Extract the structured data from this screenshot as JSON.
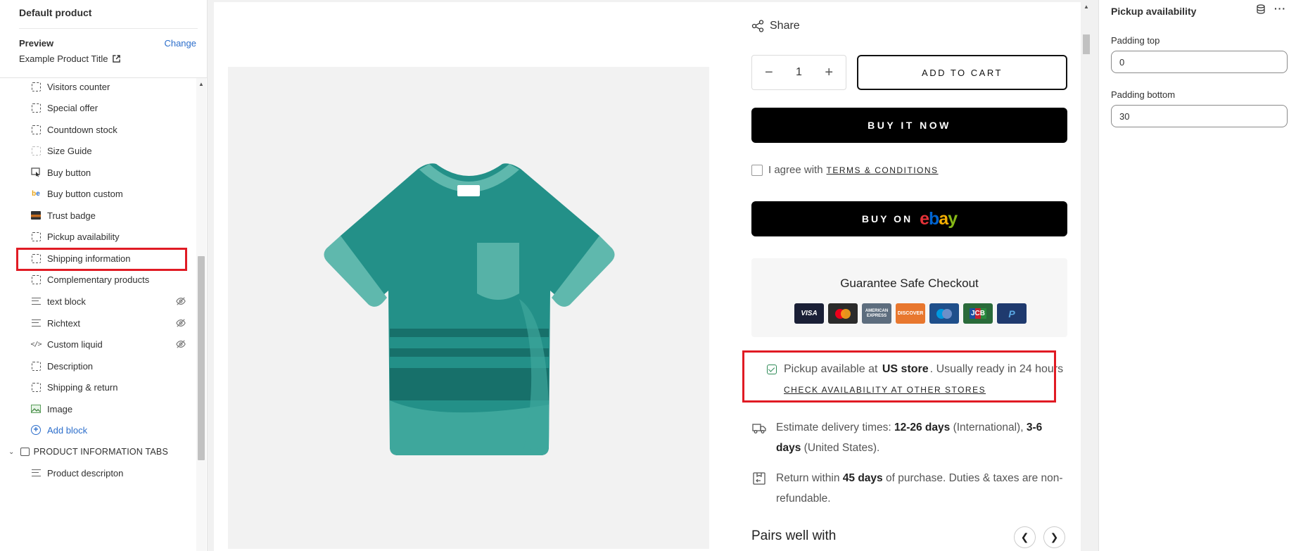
{
  "left_panel": {
    "title": "Default product",
    "preview_label": "Preview",
    "change_label": "Change",
    "product_title": "Example Product Title",
    "blocks": [
      {
        "label": "Visitors counter",
        "icon": "dashed-block-icon"
      },
      {
        "label": "Special offer",
        "icon": "dashed-block-icon"
      },
      {
        "label": "Countdown stock",
        "icon": "dashed-block-icon"
      },
      {
        "label": "Size Guide",
        "icon": "size-guide-icon"
      },
      {
        "label": "Buy button",
        "icon": "cursor-button-icon"
      },
      {
        "label": "Buy button custom",
        "icon": "be-logo-icon"
      },
      {
        "label": "Trust badge",
        "icon": "trust-badge-icon"
      },
      {
        "label": "Pickup availability",
        "icon": "dashed-block-icon",
        "selected": true
      },
      {
        "label": "Shipping information",
        "icon": "dashed-block-icon"
      },
      {
        "label": "Complementary products",
        "icon": "dashed-block-icon"
      },
      {
        "label": "text block",
        "icon": "text-lines-icon",
        "hidden": true
      },
      {
        "label": "Richtext",
        "icon": "text-lines-icon",
        "hidden": true
      },
      {
        "label": "Custom liquid",
        "icon": "code-icon",
        "hidden": true
      },
      {
        "label": "Description",
        "icon": "dashed-block-icon"
      },
      {
        "label": "Shipping & return",
        "icon": "dashed-block-icon"
      },
      {
        "label": "Image",
        "icon": "image-icon"
      }
    ],
    "add_block_label": "Add block",
    "section_header": "PRODUCT INFORMATION TABS",
    "section_child": "Product descripton"
  },
  "preview": {
    "share_label": "Share",
    "quantity": "1",
    "add_to_cart": "ADD TO CART",
    "buy_it_now": "BUY IT NOW",
    "agree_text": "I agree with",
    "terms_link": "TERMS & CONDITIONS",
    "buy_on_label": "BUY ON",
    "guarantee_title": "Guarantee Safe Checkout",
    "payment_cards": [
      {
        "name": "VISA",
        "color": "#1a1f36"
      },
      {
        "name": "mastercard",
        "color": "#2b2b2b"
      },
      {
        "name": "AMERICAN EXPRESS",
        "color": "#5d6d7e"
      },
      {
        "name": "DISCOVER",
        "color": "#e8772e"
      },
      {
        "name": "maestro",
        "color": "#1f4f8b"
      },
      {
        "name": "JCB",
        "color": "#2a6b3a"
      },
      {
        "name": "PayPal",
        "color": "#1f3a6e"
      }
    ],
    "pickup_prefix": "Pickup available at",
    "pickup_store": "US store",
    "pickup_suffix": ". Usually ready in 24 hours",
    "pickup_link": "CHECK AVAILABILITY AT OTHER STORES",
    "delivery_prefix": "Estimate delivery times:",
    "delivery_intl": "12-26 days",
    "delivery_intl_suffix": "(International),",
    "delivery_us": "3-6 days",
    "delivery_us_suffix": "(United States).",
    "return_prefix": "Return within",
    "return_days": "45 days",
    "return_suffix": "of purchase. Duties & taxes are non-refundable.",
    "pairs_title": "Pairs well with"
  },
  "settings_panel": {
    "title": "Pickup availability",
    "padding_top_label": "Padding top",
    "padding_top_value": "0",
    "padding_bottom_label": "Padding bottom",
    "padding_bottom_value": "30"
  },
  "colors": {
    "accent_blue": "#2c6ecb",
    "highlight_red": "#e01b24",
    "shirt_teal": "#239088"
  }
}
